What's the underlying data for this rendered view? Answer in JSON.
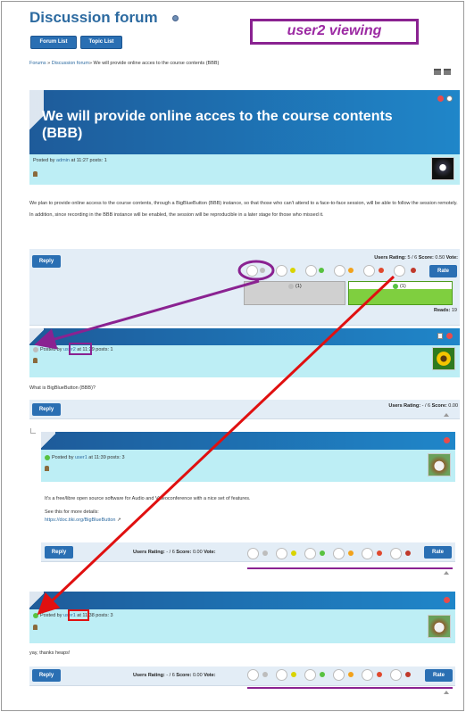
{
  "header": {
    "title": "Discussion forum",
    "forum_list_label": "Forum List",
    "topic_list_label": "Topic List",
    "annotation": "user2 viewing"
  },
  "breadcrumb": {
    "forums": "Forums",
    "sep1": " » ",
    "forum": "Discussion forum",
    "sep2": "» ",
    "topic": "We will provide online acces to the course contents (BBB)"
  },
  "first_post": {
    "title": "We will provide online acces to the course contents (BBB)",
    "posted_by_prefix": "Posted by ",
    "author": "admin",
    "posted_suffix": " at 11:27 posts: 1",
    "paragraph1": "We plan to provide online access to the course contents, through a BigBlueButton (BBB) instance, so that those who can't attend to a face-to-face session, will be able to follow the session remotely.",
    "paragraph2": "In addition, since recording in the BBB instance will be enabled, the session will be reproducible in a later stage for those who missed it.",
    "reply_label": "Reply",
    "rating_label": "Users Rating:",
    "rating_value": " 5 / 6 ",
    "score_label": "Score:",
    "score_value": " 0.50 ",
    "vote_label": "Vote:",
    "rate_label": "Rate",
    "bar_left_count": "(1)",
    "bar_right_count": "(1)",
    "reads_label": "Reads:",
    "reads_value": " 19"
  },
  "reply_user2": {
    "posted_by_prefix": "Posted by ",
    "author": "user2",
    "posted_suffix": " at 11:29 posts: 1",
    "body": "What is BigBlueButton (BBB)?",
    "reply_label": "Reply",
    "rating_label": "Users Rating:",
    "rating_value": " - / 6 ",
    "score_label": "Score:",
    "score_value": " 0.00"
  },
  "reply_user1_a": {
    "posted_by_prefix": "Posted by ",
    "author": "user1",
    "posted_suffix": " at 11:39 posts: 3",
    "body1": "It's a free/libre open source software for Audio and Videoconference with a nice set of features.",
    "body2": "See this for more details:",
    "link": "https://doc.tiki.org/BigBlueButton",
    "reply_label": "Reply",
    "rating_label": "Users Rating:",
    "rating_value": " - / 6 ",
    "score_label": "Score:",
    "score_value": " 0.00 ",
    "vote_label": "Vote:",
    "rate_label": "Rate"
  },
  "reply_user1_b": {
    "posted_by_prefix": "Posted by ",
    "author": "user1",
    "posted_suffix": " at 11:38 posts: 3",
    "body": "yay, thanks heaps!",
    "reply_label": "Reply",
    "rating_label": "Users Rating:",
    "rating_value": " - / 6 ",
    "score_label": "Score:",
    "score_value": " 0.00 ",
    "vote_label": "Vote:",
    "rate_label": "Rate"
  },
  "colors": {
    "accent": "#2a6fb3",
    "annotation_purple": "#8a2291",
    "arrow_red": "#e01010",
    "meta_band": "#bdeef5"
  }
}
